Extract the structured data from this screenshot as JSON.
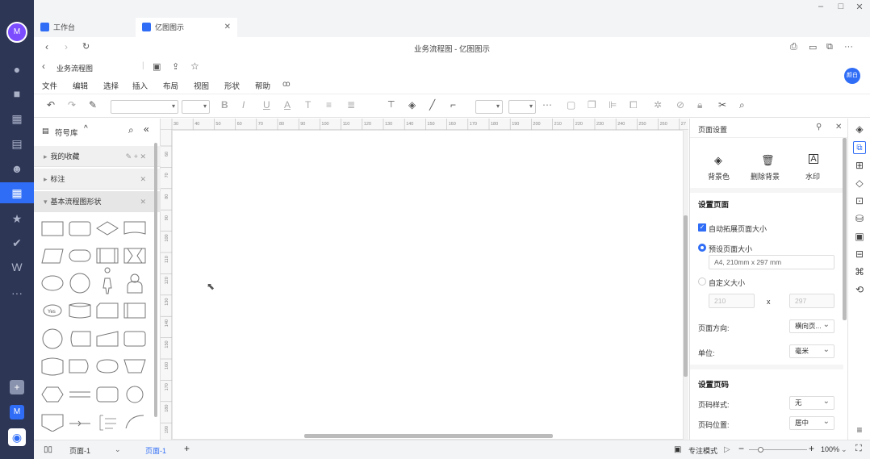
{
  "rail": {
    "avatar": "M",
    "items": [
      "chat",
      "video",
      "calendar",
      "docs",
      "contacts",
      "workbench",
      "star",
      "todo",
      "wps",
      "more"
    ],
    "bottom_m": "M"
  },
  "tabs": [
    {
      "label": "工作台",
      "active": false
    },
    {
      "label": "亿图图示",
      "active": true
    }
  ],
  "window_controls": [
    "–",
    "□",
    "✕"
  ],
  "address": {
    "title": "业务流程图 - 亿图图示"
  },
  "doc": {
    "name": "业务流程图",
    "user_badge": "颜白"
  },
  "menu": [
    "文件",
    "编辑",
    "选择",
    "插入",
    "布局",
    "视图",
    "形状",
    "帮助"
  ],
  "library": {
    "title": "符号库",
    "categories": [
      {
        "label": "我的收藏"
      },
      {
        "label": "标注"
      },
      {
        "label": "基本流程图形状"
      }
    ],
    "yes_label": "Yes"
  },
  "ruler": {
    "h": [
      "30",
      "40",
      "50",
      "60",
      "70",
      "80",
      "90",
      "100",
      "110",
      "120",
      "130",
      "140",
      "150",
      "160",
      "170",
      "180",
      "190",
      "200",
      "210",
      "220",
      "230",
      "240",
      "250",
      "260",
      "27"
    ],
    "v": [
      "60",
      "70",
      "80",
      "90",
      "100",
      "110",
      "120",
      "130",
      "140",
      "150",
      "160",
      "170",
      "180",
      "190"
    ]
  },
  "props": {
    "title": "页面设置",
    "actions": [
      "背景色",
      "删除背景",
      "水印"
    ],
    "section_page": "设置页面",
    "auto_extend": "自动拓展页面大小",
    "preset_size": "预设页面大小",
    "preset_value": "A4, 210mm x 297 mm",
    "custom_size": "自定义大小",
    "custom_w": "210",
    "custom_x": "x",
    "custom_h": "297",
    "orientation_label": "页面方向:",
    "orientation_value": "横向页...",
    "unit_label": "单位:",
    "unit_value": "毫米",
    "section_number": "设置页码",
    "num_style_label": "页码样式:",
    "num_style_value": "无",
    "num_pos_label": "页码位置:",
    "num_pos_value": "居中"
  },
  "status": {
    "page_select": "页面-1",
    "page_tab": "页面-1",
    "add": "+",
    "focus_mode": "专注模式",
    "zoom": "100%"
  },
  "colors": {
    "accent": "#2f6df6",
    "rail": "#2e3656"
  }
}
